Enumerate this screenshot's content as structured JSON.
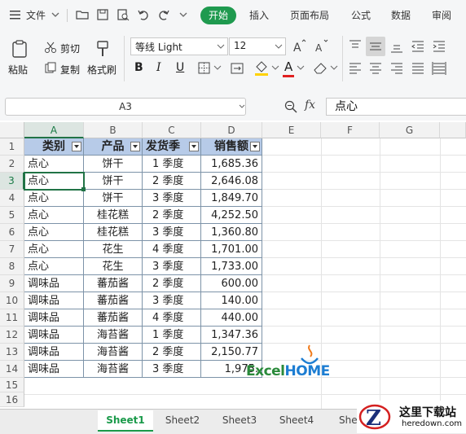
{
  "menubar": {
    "file": "文件",
    "tabs": [
      "开始",
      "插入",
      "页面布局",
      "公式",
      "数据",
      "审阅"
    ]
  },
  "ribbon": {
    "paste": "粘贴",
    "cut": "剪切",
    "copy": "复制",
    "format_painter": "格式刷",
    "font_name": "等线 Light",
    "font_size": "12",
    "bold": "B",
    "italic": "I",
    "underline": "U",
    "font_color_letter": "A"
  },
  "formula_bar": {
    "name_box": "A3",
    "fx": "fx",
    "value": "点心"
  },
  "columns": [
    "A",
    "B",
    "C",
    "D",
    "E",
    "F",
    "G"
  ],
  "rows": [
    "1",
    "2",
    "3",
    "4",
    "5",
    "6",
    "7",
    "8",
    "9",
    "10",
    "11",
    "12",
    "13",
    "14",
    "15",
    "16"
  ],
  "table": {
    "headers": [
      "类别",
      "产品",
      "发货季",
      "销售额"
    ],
    "rows": [
      [
        "点心",
        "饼干",
        "1 季度",
        "1,685.36"
      ],
      [
        "点心",
        "饼干",
        "2 季度",
        "2,646.08"
      ],
      [
        "点心",
        "饼干",
        "3 季度",
        "1,849.70"
      ],
      [
        "点心",
        "桂花糕",
        "2 季度",
        "4,252.50"
      ],
      [
        "点心",
        "桂花糕",
        "3 季度",
        "1,360.80"
      ],
      [
        "点心",
        "花生",
        "4 季度",
        "1,701.00"
      ],
      [
        "点心",
        "花生",
        "3 季度",
        "1,733.00"
      ],
      [
        "调味品",
        "蕃茄酱",
        "2 季度",
        "600.00"
      ],
      [
        "调味品",
        "蕃茄酱",
        "3 季度",
        "140.00"
      ],
      [
        "调味品",
        "蕃茄酱",
        "4 季度",
        "440.00"
      ],
      [
        "调味品",
        "海苔酱",
        "1 季度",
        "1,347.36"
      ],
      [
        "调味品",
        "海苔酱",
        "2 季度",
        "2,150.77"
      ],
      [
        "调味品",
        "海苔酱",
        "3 季度",
        "1,975."
      ]
    ]
  },
  "watermark": {
    "excel": "Excel",
    "home": "HOME"
  },
  "corner_logo": {
    "text": "这里下载站",
    "url": "heredown.com"
  },
  "sheets": [
    "Sheet1",
    "Sheet2",
    "Sheet3",
    "Sheet4",
    "She"
  ],
  "colors": {
    "accent": "#1f9a4f",
    "header_fill": "#b7cbe8",
    "selection": "#217346"
  }
}
